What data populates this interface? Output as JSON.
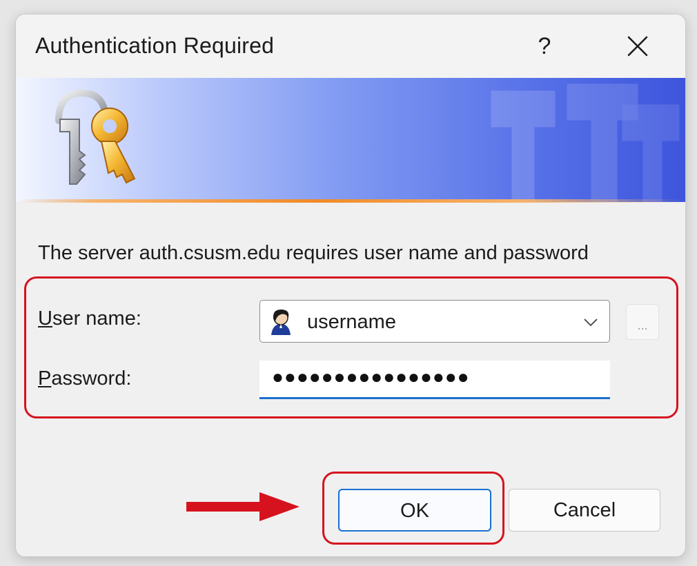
{
  "dialog": {
    "title": "Authentication Required",
    "help_label": "?",
    "message": "The server auth.csusm.edu requires user name and password"
  },
  "fields": {
    "username_label_access": "U",
    "username_label_rest": "ser name:",
    "username_value": "username",
    "browse_label": "...",
    "password_label_access": "P",
    "password_label_rest": "assword:",
    "password_mask": "●●●●●●●●●●●●●●●●"
  },
  "buttons": {
    "ok_label": "OK",
    "cancel_label": "Cancel"
  },
  "icons": {
    "banner": "keys-icon",
    "user": "user-avatar-icon",
    "close": "close-icon",
    "dropdown": "chevron-down-icon",
    "annotation": "arrow-right-icon"
  },
  "colors": {
    "accent": "#1a6fcf",
    "annotation": "#d6121e",
    "banner_start": "#f3f6ff",
    "banner_end": "#3d55dc",
    "rule": "#f08a2a"
  }
}
